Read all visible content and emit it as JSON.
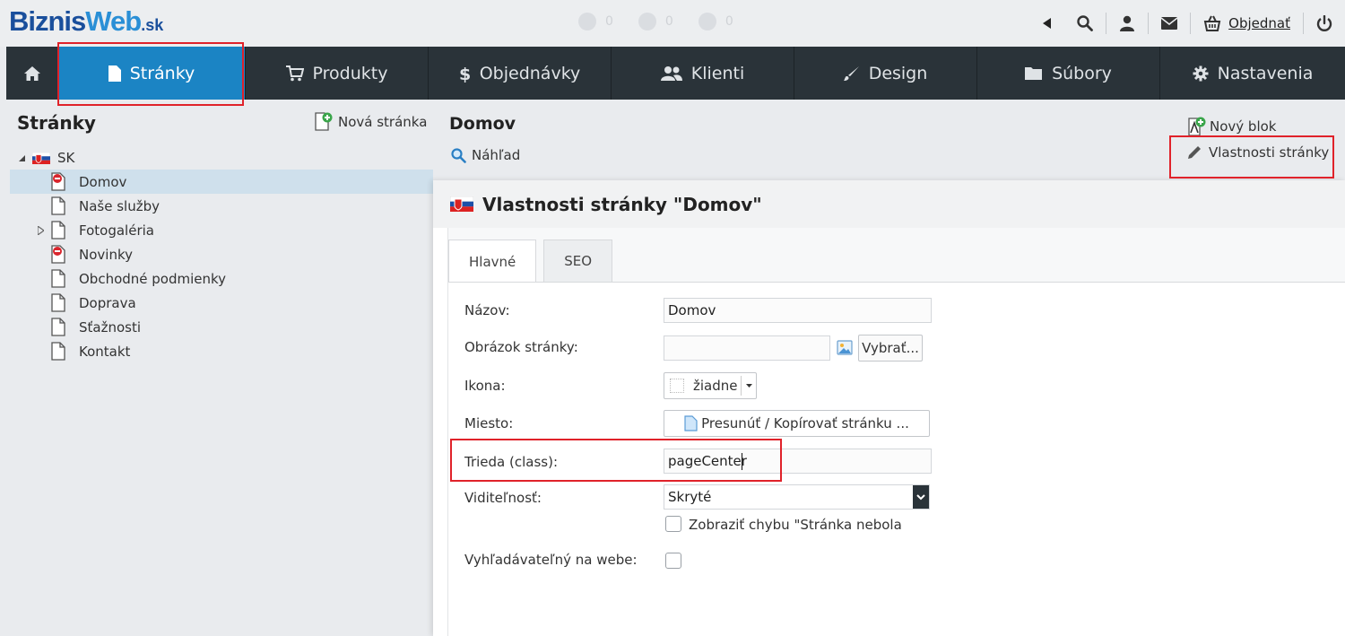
{
  "logo": {
    "part1": "Biznis",
    "part2": "Web",
    "tld": ".sk"
  },
  "faint_counts": [
    "0",
    "0",
    "0"
  ],
  "toolbar": {
    "order_label": "Objednať"
  },
  "nav": [
    {
      "label": "Stránky",
      "icon": "file-icon"
    },
    {
      "label": "Produkty",
      "icon": "cart-icon"
    },
    {
      "label": "Objednávky",
      "icon": "dollar-icon"
    },
    {
      "label": "Klienti",
      "icon": "users-icon"
    },
    {
      "label": "Design",
      "icon": "brush-icon"
    },
    {
      "label": "Súbory",
      "icon": "folder-icon"
    },
    {
      "label": "Nastavenia",
      "icon": "gear-icon"
    }
  ],
  "left": {
    "title": "Stránky",
    "new_page": "Nová stránka",
    "root": "SK",
    "items": [
      "Domov",
      "Naše služby",
      "Fotogaléria",
      "Novinky",
      "Obchodné podmienky",
      "Doprava",
      "Sťažnosti",
      "Kontakt"
    ]
  },
  "middle": {
    "title": "Domov",
    "preview": "Náhľad",
    "new_block": "Nový blok",
    "page_props": "Vlastnosti stránky"
  },
  "dialog": {
    "title": "Vlastnosti stránky \"Domov\"",
    "tabs": [
      "Hlavné",
      "SEO"
    ],
    "fields": {
      "name_label": "Názov:",
      "name_value": "Domov",
      "image_label": "Obrázok stránky:",
      "image_value": "",
      "choose_label": "Vybrať...",
      "icon_label": "Ikona:",
      "icon_value": "žiadne",
      "place_label": "Miesto:",
      "place_button": "Presunúť / Kopírovať stránku ...",
      "class_label": "Trieda (class):",
      "class_value": "pageCenter",
      "visibility_label": "Viditeľnosť:",
      "visibility_value": "Skryté",
      "show_error_label": "Zobraziť chybu \"Stránka nebola",
      "searchable_label": "Vyhľadávateľný na webe:"
    }
  }
}
